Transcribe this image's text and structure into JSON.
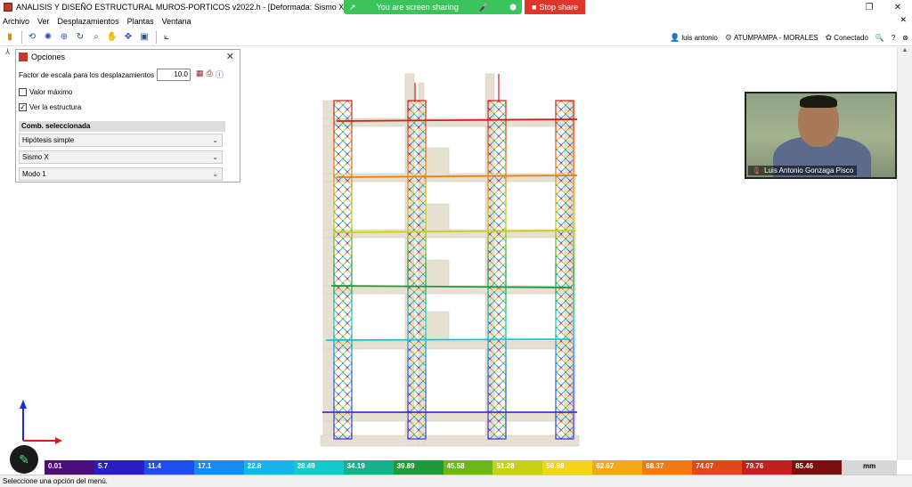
{
  "titlebar": {
    "title": "ANALISIS Y DISEÑO ESTRUCTURAL MUROS-PORTICOS v2022.h - [Deformada: Sismo X: Modo 1",
    "share_text": "You are screen sharing",
    "stop_label": "Stop share"
  },
  "menu": {
    "items": [
      "Archivo",
      "Ver",
      "Desplazamientos",
      "Plantas",
      "Ventana"
    ]
  },
  "toolbar": {
    "user": "luis antonio",
    "project": "ATUMPAMPA - MORALES",
    "status": "Conectado"
  },
  "panel": {
    "title": "Opciones",
    "scale_label": "Factor de escala para los desplazamientos",
    "scale_value": "10.0",
    "max_label": "Valor máximo",
    "max_checked": false,
    "structure_label": "Ver la estructura",
    "structure_checked": true,
    "comb_header": "Comb. seleccionada",
    "hypothesis": "Hipótesis simple",
    "seismic": "Sismo X",
    "mode": "Modo 1"
  },
  "webcam": {
    "name": "Luis Antonio Gonzaga Pisco"
  },
  "legend": {
    "unit": "mm",
    "values": [
      "0.01",
      "5.7",
      "11.4",
      "17.1",
      "22.8",
      "28.49",
      "34.19",
      "39.89",
      "45.58",
      "51.28",
      "56.98",
      "62.67",
      "68.37",
      "74.07",
      "79.76",
      "85.46"
    ],
    "colors": [
      "#4b0f7a",
      "#2b1dc4",
      "#1f4ef0",
      "#1a8af0",
      "#16b7e8",
      "#14c9c9",
      "#17b08a",
      "#1f9a3a",
      "#6cb71a",
      "#c9d115",
      "#f3d418",
      "#f4a917",
      "#ef7a16",
      "#e4461b",
      "#c41f1f",
      "#7a0f0f"
    ]
  },
  "status": {
    "text": "Seleccione una opción del menú."
  }
}
